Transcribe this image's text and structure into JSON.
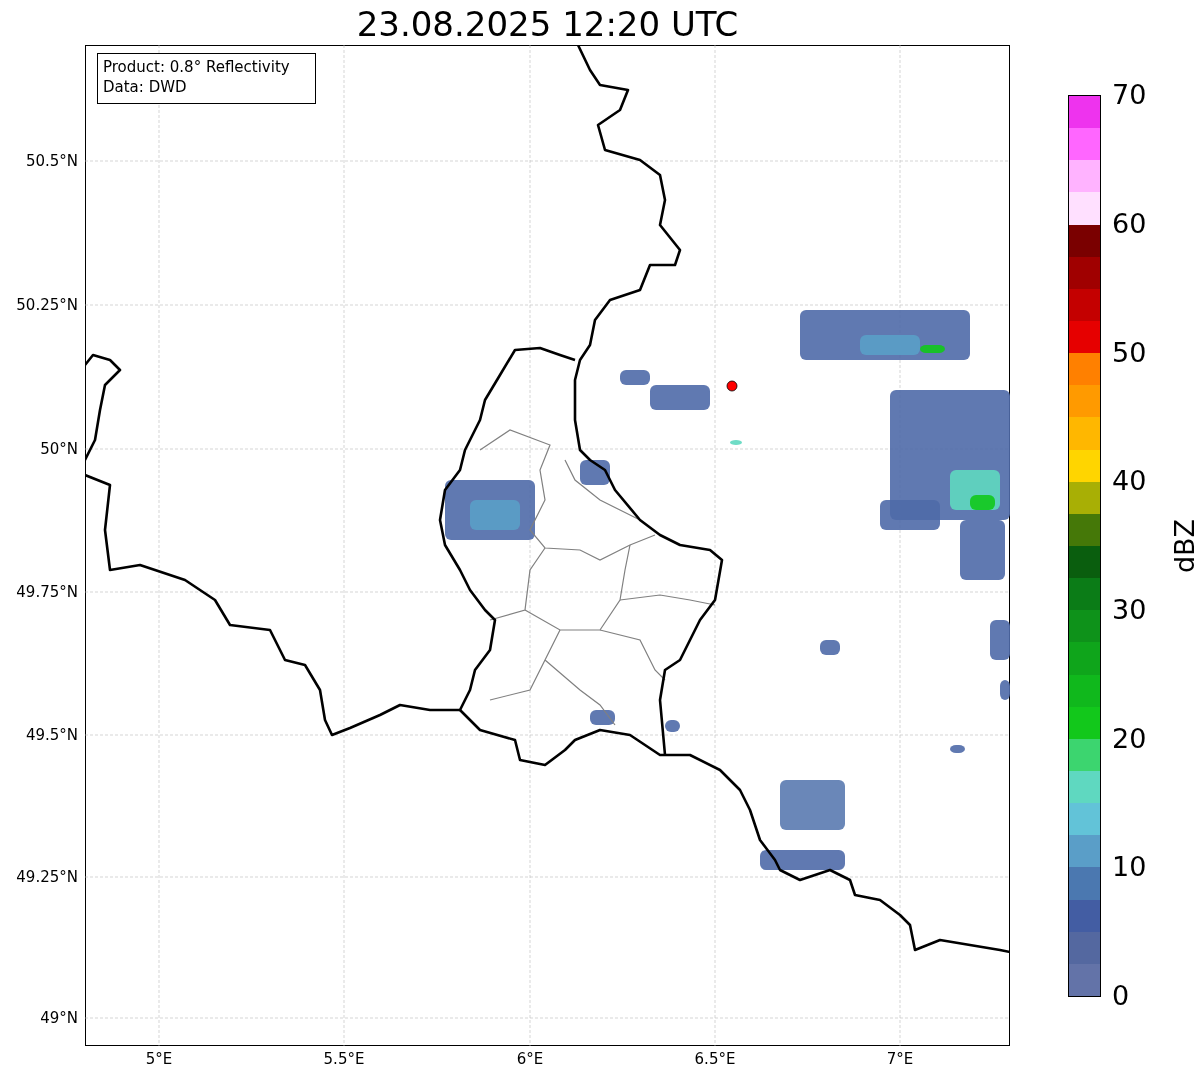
{
  "title": "23.08.2025 12:20 UTC",
  "legend": [
    "Product: 0.8° Reflectivity",
    "Data: DWD"
  ],
  "map": {
    "lat_ticks": [
      "50.5°N",
      "50.25°N",
      "50°N",
      "49.75°N",
      "49.5°N",
      "49.25°N",
      "49°N"
    ],
    "lon_ticks": [
      "5°E",
      "5.5°E",
      "6°E",
      "6.5°E",
      "7°E"
    ]
  },
  "colorbar": {
    "label": "dBZ",
    "ticks": [
      "70",
      "60",
      "50",
      "40",
      "30",
      "20",
      "10",
      "0"
    ],
    "segments": [
      {
        "color": "#6373a8"
      },
      {
        "color": "#5468a0"
      },
      {
        "color": "#435da3"
      },
      {
        "color": "#4b78b0"
      },
      {
        "color": "#5a9ec8"
      },
      {
        "color": "#62c3d8"
      },
      {
        "color": "#5fd8c0"
      },
      {
        "color": "#3cd56f"
      },
      {
        "color": "#12c81b"
      },
      {
        "color": "#10b81c"
      },
      {
        "color": "#0fa51b"
      },
      {
        "color": "#0e921a"
      },
      {
        "color": "#0b7c17"
      },
      {
        "color": "#0a5e0e"
      },
      {
        "color": "#457808"
      },
      {
        "color": "#a8af05"
      },
      {
        "color": "#ffd500"
      },
      {
        "color": "#ffb700"
      },
      {
        "color": "#ff9a00"
      },
      {
        "color": "#ff8000"
      },
      {
        "color": "#e60000"
      },
      {
        "color": "#c40000"
      },
      {
        "color": "#a00000"
      },
      {
        "color": "#7a0000"
      },
      {
        "color": "#ffe0ff"
      },
      {
        "color": "#ffb3ff"
      },
      {
        "color": "#ff66ff"
      },
      {
        "color": "#ee33ee"
      }
    ]
  }
}
